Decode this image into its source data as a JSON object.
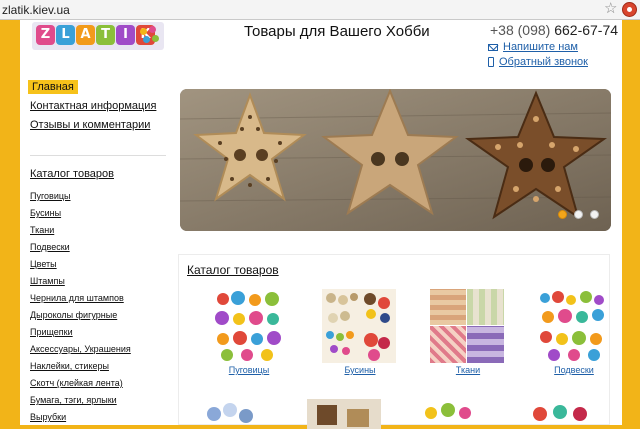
{
  "browser": {
    "url": "zlatik.kiev.ua",
    "bookmark_icon": "star-icon",
    "extension_icon": "extension-icon"
  },
  "header": {
    "logo_letters": [
      "Z",
      "L",
      "A",
      "T",
      "I",
      "K"
    ],
    "logo_colors": [
      "#e04b8c",
      "#3aa0d8",
      "#f29a1c",
      "#8bbf3a",
      "#a04bc8",
      "#e0483a"
    ],
    "title": "Товары для Вашего Хобби",
    "phone_code": "+38 (098)",
    "phone_number": "662-67-74",
    "mail_link": "Напишите нам",
    "call_link": "Обратный звонок"
  },
  "sidebar": {
    "main_menu": [
      "Главная",
      "Контактная информация",
      "Отзывы и комментарии"
    ],
    "active_index": 0,
    "catalog_title": "Каталог товаров",
    "categories": [
      "Пуговицы",
      "Бусины",
      "Ткани",
      "Подвески",
      "Цветы",
      "Штампы",
      "Чернила для штампов",
      "Дыроколы фигурные",
      "Прищепки",
      "Аксессуары, Украшения",
      "Наклейки, стикеры",
      "Скотч (клейкая лента)",
      "Бумага, тэги, ярлыки",
      "Вырубки"
    ]
  },
  "slider": {
    "slide_count": 3,
    "active_slide": 0
  },
  "catalog": {
    "title": "Каталог товаров",
    "products": [
      "Пуговицы",
      "Бусины",
      "Ткани",
      "Подвески"
    ]
  },
  "colors": {
    "page_bg": "#f2b418",
    "accent": "#f6c21a",
    "link": "#1e5fa8"
  }
}
